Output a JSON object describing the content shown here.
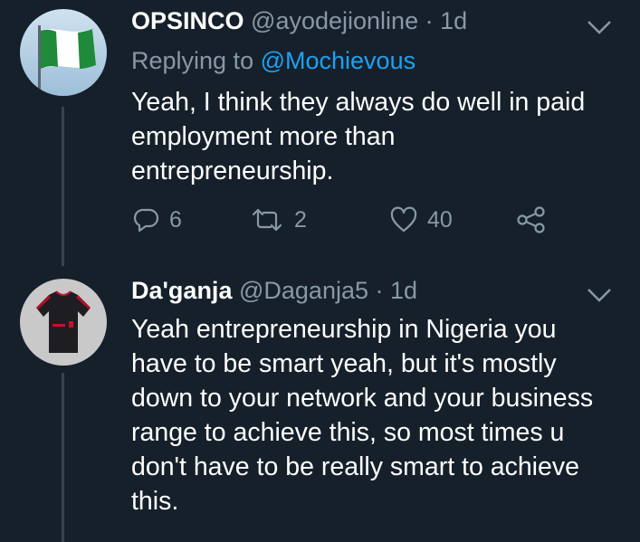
{
  "tweets": [
    {
      "name": "OPSINCO",
      "handle": "@ayodejionline",
      "separator": "·",
      "time": "1d",
      "replying_prefix": "Replying to",
      "replying_to": "@Mochievous",
      "lines": [
        "Yeah, I think they always do well in paid",
        "employment more than",
        "entrepreneurship."
      ],
      "stats": {
        "replies": "6",
        "retweets": "2",
        "likes": "40"
      }
    },
    {
      "name": "Da'ganja",
      "handle": "@Daganja5",
      "separator": "·",
      "time": "1d",
      "lines": [
        "Yeah entrepreneurship in Nigeria you",
        "have to be smart yeah, but it's mostly",
        "down to your network and your business",
        "range to achieve this, so most times u",
        "don't have to be really smart to achieve",
        "this."
      ]
    }
  ],
  "colors": {
    "background": "#15202b",
    "muted": "#8899a6",
    "accent": "#1da1f2",
    "thread_line": "#38444d"
  },
  "icons": {
    "reply": "reply-icon",
    "retweet": "retweet-icon",
    "like": "heart-icon",
    "share": "share-icon",
    "menu": "chevron-down-icon"
  }
}
